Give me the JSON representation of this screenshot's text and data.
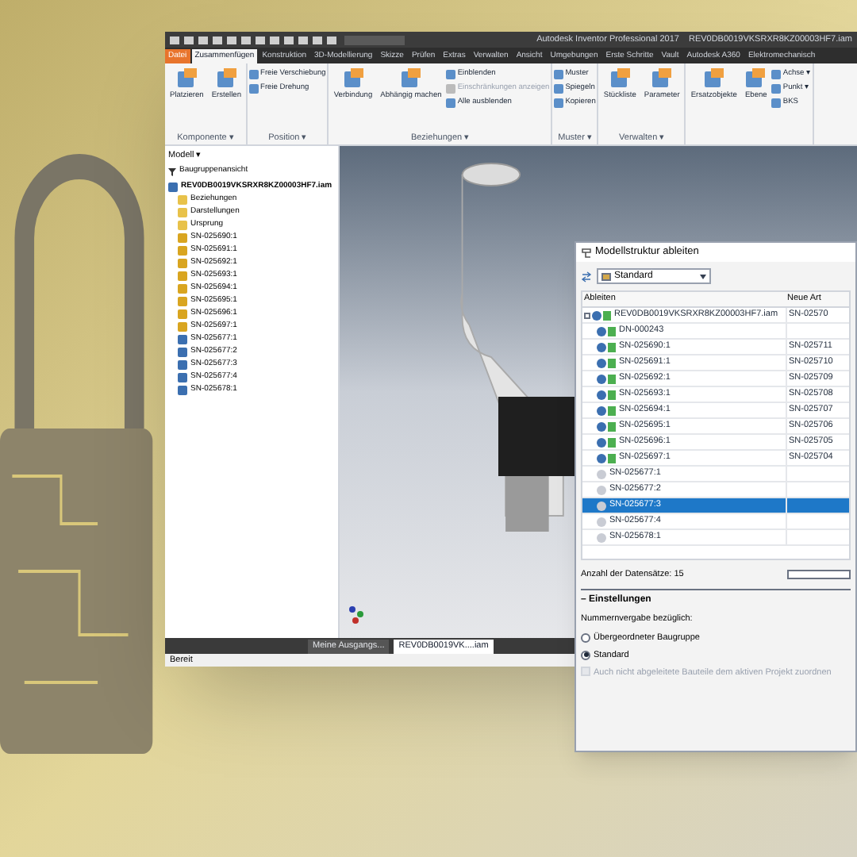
{
  "window": {
    "app_title": "Autodesk Inventor Professional 2017",
    "file_title": "REV0DB0019VKSRXR8KZ00003HF7.iam"
  },
  "ribbon": {
    "tabs": [
      {
        "label": "Datei",
        "kind": "file",
        "selected": false
      },
      {
        "label": "Zusammenfügen",
        "kind": "tab",
        "selected": true
      },
      {
        "label": "Konstruktion",
        "kind": "tab",
        "selected": false
      },
      {
        "label": "3D-Modellierung",
        "kind": "tab",
        "selected": false
      },
      {
        "label": "Skizze",
        "kind": "tab",
        "selected": false
      },
      {
        "label": "Prüfen",
        "kind": "tab",
        "selected": false
      },
      {
        "label": "Extras",
        "kind": "tab",
        "selected": false
      },
      {
        "label": "Verwalten",
        "kind": "tab",
        "selected": false
      },
      {
        "label": "Ansicht",
        "kind": "tab",
        "selected": false
      },
      {
        "label": "Umgebungen",
        "kind": "tab",
        "selected": false
      },
      {
        "label": "Erste Schritte",
        "kind": "tab",
        "selected": false
      },
      {
        "label": "Vault",
        "kind": "tab",
        "selected": false
      },
      {
        "label": "Autodesk A360",
        "kind": "tab",
        "selected": false
      },
      {
        "label": "Elektromechanisch",
        "kind": "tab",
        "selected": false
      }
    ],
    "groups": [
      {
        "label": "Komponente ▾",
        "tools": [
          {
            "label": "Platzieren",
            "kind": "large",
            "disabled": false
          },
          {
            "label": "Erstellen",
            "kind": "large",
            "disabled": false
          }
        ]
      },
      {
        "label": "Position ▾",
        "tools": [
          {
            "label": "Freie Verschiebung",
            "kind": "small",
            "disabled": false
          },
          {
            "label": "Freie Drehung",
            "kind": "small",
            "disabled": false
          }
        ]
      },
      {
        "label": "Beziehungen ▾",
        "tools": [
          {
            "label": "Verbindung",
            "kind": "large",
            "disabled": false
          },
          {
            "label": "Abhängig machen",
            "kind": "large",
            "disabled": false
          },
          {
            "label": "Einblenden",
            "kind": "small",
            "disabled": false
          },
          {
            "label": "Einschränkungen anzeigen",
            "kind": "small",
            "disabled": true
          },
          {
            "label": "Alle ausblenden",
            "kind": "small",
            "disabled": false
          }
        ]
      },
      {
        "label": "Muster ▾",
        "tools": [
          {
            "label": "Muster",
            "kind": "small",
            "disabled": false
          },
          {
            "label": "Spiegeln",
            "kind": "small",
            "disabled": false
          },
          {
            "label": "Kopieren",
            "kind": "small",
            "disabled": false
          }
        ]
      },
      {
        "label": "Verwalten ▾",
        "tools": [
          {
            "label": "Stückliste",
            "kind": "large",
            "disabled": false
          },
          {
            "label": "Parameter",
            "kind": "large",
            "disabled": false
          }
        ]
      },
      {
        "tools": [
          {
            "label": "Ersatzobjekte",
            "kind": "large",
            "disabled": false
          },
          {
            "label": "Ebene",
            "kind": "large",
            "disabled": false
          },
          {
            "label": "Achse ▾",
            "kind": "small",
            "disabled": false
          },
          {
            "label": "Punkt ▾",
            "kind": "small",
            "disabled": false
          },
          {
            "label": "BKS",
            "kind": "small",
            "disabled": false
          }
        ]
      }
    ]
  },
  "browser": {
    "header": "Modell ▾",
    "view": "Baugruppenansicht",
    "tree": [
      {
        "label": "REV0DB0019VKSRXR8KZ00003HF7.iam",
        "kind": "assembly",
        "children": [
          {
            "label": "Beziehungen",
            "kind": "folder"
          },
          {
            "label": "Darstellungen",
            "kind": "folder"
          },
          {
            "label": "Ursprung",
            "kind": "folder"
          },
          {
            "label": "SN-025690:1",
            "kind": "part"
          },
          {
            "label": "SN-025691:1",
            "kind": "part"
          },
          {
            "label": "SN-025692:1",
            "kind": "part"
          },
          {
            "label": "SN-025693:1",
            "kind": "part"
          },
          {
            "label": "SN-025694:1",
            "kind": "part"
          },
          {
            "label": "SN-025695:1",
            "kind": "part"
          },
          {
            "label": "SN-025696:1",
            "kind": "part"
          },
          {
            "label": "SN-025697:1",
            "kind": "part"
          },
          {
            "label": "SN-025677:1",
            "kind": "assembly"
          },
          {
            "label": "SN-025677:2",
            "kind": "assembly"
          },
          {
            "label": "SN-025677:3",
            "kind": "assembly"
          },
          {
            "label": "SN-025677:4",
            "kind": "assembly"
          },
          {
            "label": "SN-025678:1",
            "kind": "assembly"
          }
        ]
      }
    ]
  },
  "dialog": {
    "title": "Modellstruktur ableiten",
    "style": "Standard",
    "columns": [
      "Ableiten",
      "Neue Art"
    ],
    "rows": [
      {
        "name": "REV0DB0019VKSRXR8KZ00003HF7.iam",
        "value": "SN-02570",
        "kind": "root",
        "selected": false
      },
      {
        "name": "DN-000243",
        "kind": "derived",
        "selected": false
      },
      {
        "name": "SN-025690:1",
        "value": "SN-025711",
        "kind": "derived",
        "selected": false
      },
      {
        "name": "SN-025691:1",
        "value": "SN-025710",
        "kind": "derived",
        "selected": false
      },
      {
        "name": "SN-025692:1",
        "value": "SN-025709",
        "kind": "derived",
        "selected": false
      },
      {
        "name": "SN-025693:1",
        "value": "SN-025708",
        "kind": "derived",
        "selected": false
      },
      {
        "name": "SN-025694:1",
        "value": "SN-025707",
        "kind": "derived",
        "selected": false
      },
      {
        "name": "SN-025695:1",
        "value": "SN-025706",
        "kind": "derived",
        "selected": false
      },
      {
        "name": "SN-025696:1",
        "value": "SN-025705",
        "kind": "derived",
        "selected": false
      },
      {
        "name": "SN-025697:1",
        "value": "SN-025704",
        "kind": "derived",
        "selected": false
      },
      {
        "name": "SN-025677:1",
        "kind": "plain",
        "selected": false
      },
      {
        "name": "SN-025677:2",
        "kind": "plain",
        "selected": false
      },
      {
        "name": "SN-025677:3",
        "kind": "plain",
        "selected": true
      },
      {
        "name": "SN-025677:4",
        "kind": "plain",
        "selected": false
      },
      {
        "name": "SN-025678:1",
        "kind": "plain",
        "selected": false
      }
    ],
    "count": "Anzahl der Datensätze: 15",
    "settings": {
      "legend": "– Einstellungen",
      "label": "Nummernvergabe bezüglich:",
      "options": [
        {
          "label": "Übergeordneter Baugruppe",
          "selected": false
        },
        {
          "label": "Standard",
          "selected": true
        }
      ],
      "checkbox": {
        "label": "Auch nicht abgeleitete Bauteile dem aktiven Projekt zuordnen",
        "checked": false,
        "disabled": true
      }
    }
  },
  "doc_tabs": [
    {
      "label": "Meine Ausgangs...",
      "selected": false
    },
    {
      "label": "REV0DB0019VK....iam",
      "selected": true
    }
  ],
  "status": "Bereit"
}
